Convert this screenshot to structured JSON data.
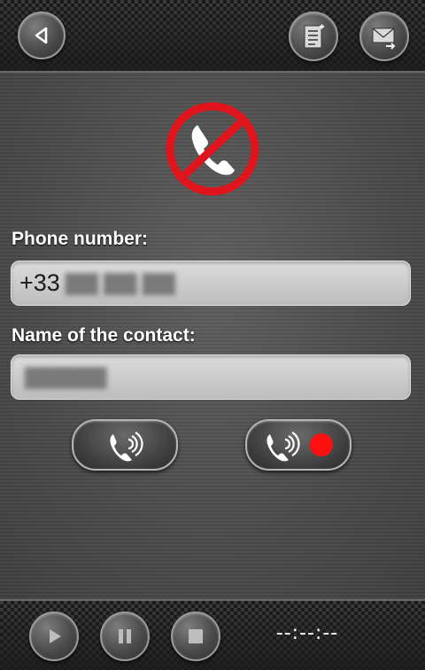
{
  "header": {
    "back_icon": "back-triangle-icon",
    "contacts_icon": "contacts-list-icon",
    "send_icon": "envelope-send-icon"
  },
  "status_icon": "blocked-phone-icon",
  "form": {
    "phone_label": "Phone number:",
    "phone_value_visible": "+33",
    "name_label": "Name of the contact:"
  },
  "actions": {
    "call_icon": "phone-call-icon",
    "call_record_icon": "phone-call-record-icon"
  },
  "player": {
    "play_icon": "play-icon",
    "pause_icon": "pause-icon",
    "stop_icon": "stop-icon",
    "time": "--:--:--"
  },
  "colors": {
    "record_red": "#ff1010",
    "block_red": "#e0141c"
  }
}
